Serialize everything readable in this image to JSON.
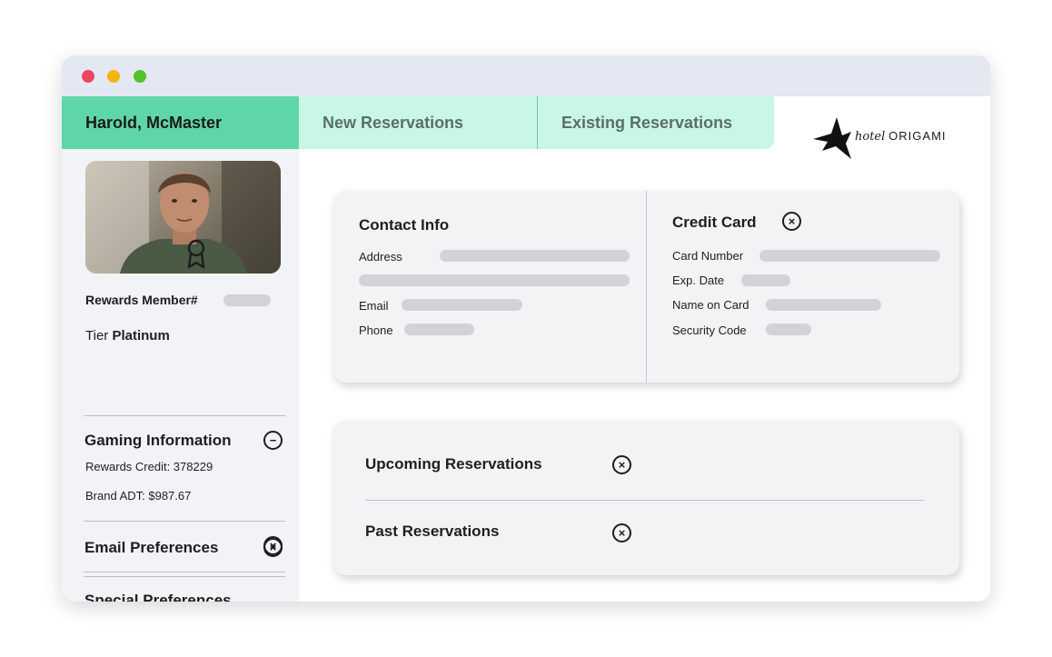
{
  "header": {
    "user_tab": "Harold, McMaster",
    "tabs": [
      {
        "label": "New Reservations"
      },
      {
        "label": "Existing Reservations"
      }
    ],
    "logo": {
      "script": "hotel",
      "brand": "ORIGAMI"
    }
  },
  "sidebar": {
    "rewards_label": "Rewards Member#",
    "tier_prefix": "Tier",
    "tier_value": "Platinum",
    "gaming": {
      "title": "Gaming Information",
      "rewards_credit": "Rewards Credit: 378229",
      "brand_adt": "Brand ADT: $987.67"
    },
    "email_preferences": "Email Preferences",
    "special_preferences": "Special Preferences"
  },
  "contact": {
    "title": "Contact Info",
    "address": "Address",
    "email": "Email",
    "phone": "Phone"
  },
  "credit_card": {
    "title": "Credit Card",
    "card_number": "Card Number",
    "exp_date": "Exp. Date",
    "name_on_card": "Name on Card",
    "security_code": "Security Code"
  },
  "reservations": {
    "upcoming": "Upcoming Reservations",
    "past": "Past Reservations"
  },
  "icons": {
    "close": "×",
    "collapse": "−"
  },
  "colors": {
    "active_tab": "#5fd6a8",
    "inactive_tab": "#c8f7e6",
    "window_dot_red": "#f0455f",
    "window_dot_yellow": "#f5b70e",
    "window_dot_green": "#51c22c"
  }
}
